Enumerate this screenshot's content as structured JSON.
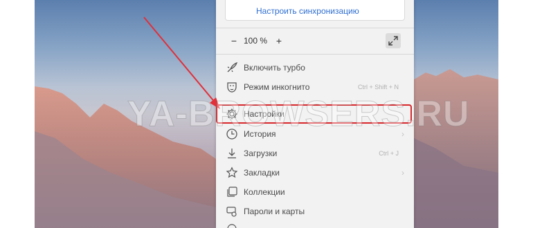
{
  "menu": {
    "sync_link": "Настроить синхронизацию",
    "zoom": {
      "minus": "−",
      "value": "100 %",
      "plus": "+"
    },
    "items": [
      {
        "label": "Включить турбо",
        "icon": "turbo-rocket-icon",
        "shortcut": "",
        "chevron": ""
      },
      {
        "label": "Режим инкогнито",
        "icon": "incognito-mask-icon",
        "shortcut": "Ctrl + Shift + N",
        "chevron": ""
      },
      {
        "label": "Настройки",
        "icon": "gear-icon",
        "shortcut": "",
        "chevron": ""
      },
      {
        "label": "История",
        "icon": "clock-icon",
        "shortcut": "",
        "chevron": "›"
      },
      {
        "label": "Загрузки",
        "icon": "download-icon",
        "shortcut": "Ctrl + J",
        "chevron": ""
      },
      {
        "label": "Закладки",
        "icon": "star-icon",
        "shortcut": "",
        "chevron": "›"
      },
      {
        "label": "Коллекции",
        "icon": "collections-icon",
        "shortcut": "",
        "chevron": ""
      },
      {
        "label": "Пароли и карты",
        "icon": "key-icon",
        "shortcut": "",
        "chevron": ""
      }
    ]
  },
  "watermark": "YA-BROWSERS.RU",
  "colors": {
    "highlight": "#d8262b",
    "link": "#2f6fd1",
    "arrow": "#e0303a"
  }
}
